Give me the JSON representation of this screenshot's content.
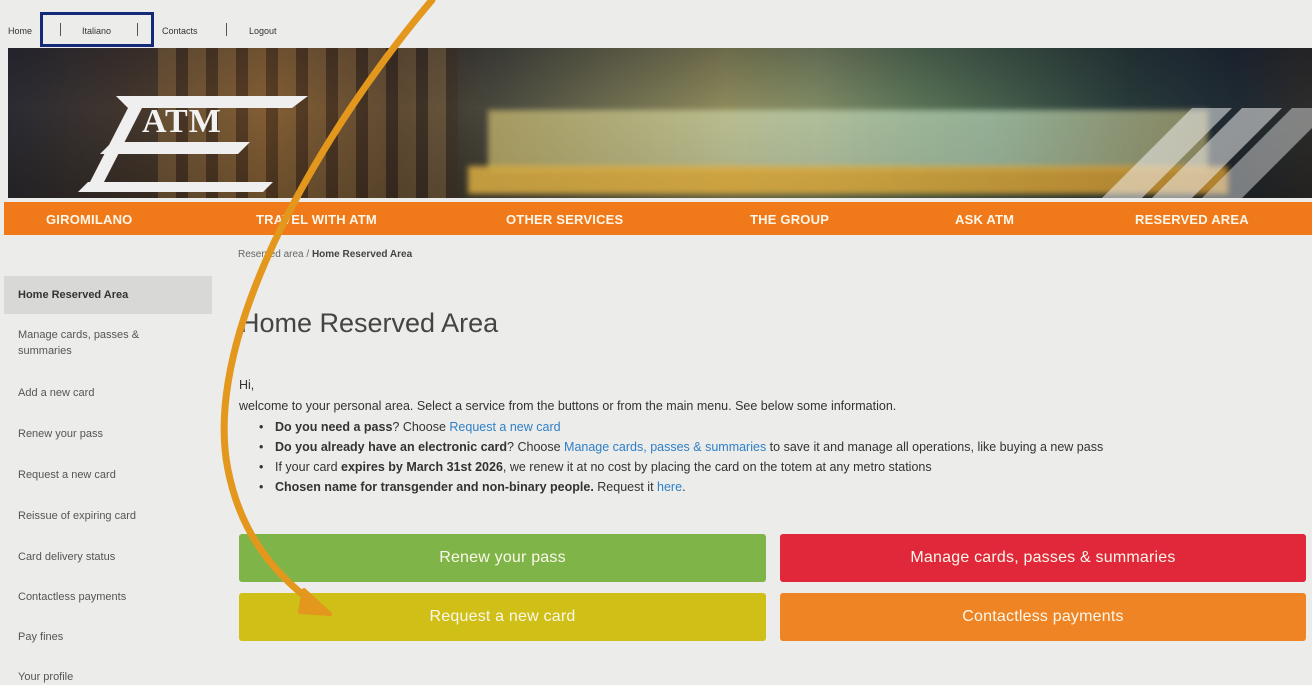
{
  "toplinks": {
    "home": "Home",
    "language": "Italiano",
    "contacts": "Contacts",
    "logout": "Logout"
  },
  "logo": {
    "text": "ATM"
  },
  "mainnav": [
    "GIROMILANO",
    "TRAVEL WITH ATM",
    "OTHER SERVICES",
    "THE GROUP",
    "ASK ATM",
    "RESERVED AREA"
  ],
  "breadcrumb": {
    "parent": "Reserved area",
    "separator": "/",
    "current": "Home Reserved Area"
  },
  "sidebar": [
    {
      "label": "Home Reserved Area"
    },
    {
      "label": "Manage cards, passes & summaries"
    },
    {
      "label": "Add a new card"
    },
    {
      "label": "Renew your pass"
    },
    {
      "label": "Request a new card"
    },
    {
      "label": "Reissue of expiring card"
    },
    {
      "label": "Card delivery status"
    },
    {
      "label": "Contactless payments"
    },
    {
      "label": "Pay fines"
    },
    {
      "label": "Your profile"
    }
  ],
  "main": {
    "title": "Home Reserved Area",
    "greeting": "Hi,",
    "welcome": "welcome to your personal area. Select a service from the buttons or from the main menu. See below some information.",
    "b1_bold": "Do you need a pass",
    "b1_text": "? Choose ",
    "b1_link": "Request a new card",
    "b2_bold": "Do you already have an electronic card",
    "b2_text": "? Choose ",
    "b2_link": "Manage cards, passes & summaries",
    "b2_tail": " to save it and manage all operations, like buying a new pass",
    "b3_text": "If your card ",
    "b3_bold": "expires by March 31st 2026",
    "b3_tail": ", we renew it at no cost by placing the card on the totem at any metro stations",
    "b4_bold": "Chosen name for transgender and non-binary people.",
    "b4_text": " Request it ",
    "b4_link": "here",
    "b4_tail": "."
  },
  "buttons": {
    "renew": "Renew your pass",
    "manage": "Manage cards, passes & summaries",
    "request": "Request a new card",
    "contactless": "Contactless payments"
  },
  "colors": {
    "nav_orange": "#f07a1a",
    "btn_green": "#7fb548",
    "btn_red": "#e0283a",
    "btn_yellow": "#cfbf16",
    "btn_orange": "#ee8424",
    "arrow": "#e3971c",
    "highlight": "#162a7a",
    "link": "#2f80c8"
  }
}
